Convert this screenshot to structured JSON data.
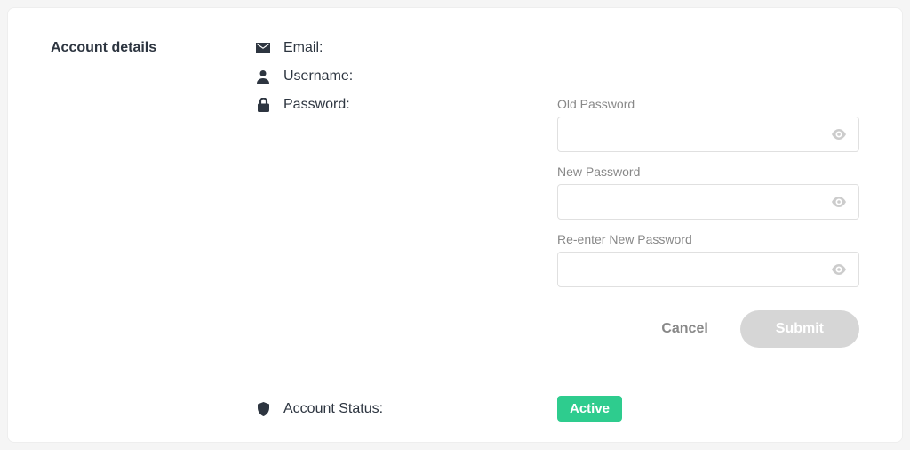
{
  "section_title": "Account details",
  "fields": {
    "email_label": "Email:",
    "username_label": "Username:",
    "password_label": "Password:",
    "status_label": "Account Status:"
  },
  "password_form": {
    "old_label": "Old Password",
    "new_label": "New Password",
    "reenter_label": "Re-enter New Password",
    "old_value": "",
    "new_value": "",
    "reenter_value": "",
    "cancel_label": "Cancel",
    "submit_label": "Submit"
  },
  "status": {
    "badge": "Active"
  },
  "colors": {
    "text_dark": "#2d3540",
    "muted": "#888",
    "border": "#e0e0e0",
    "submit_disabled": "#d6d6d6",
    "active_badge": "#2ecc8e"
  }
}
